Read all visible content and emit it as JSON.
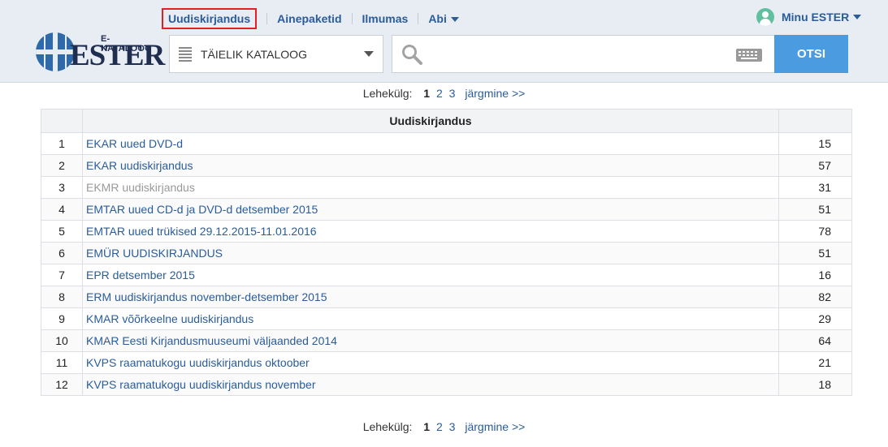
{
  "nav": {
    "items": [
      {
        "label": "Uudiskirjandus"
      },
      {
        "label": "Ainepaketid"
      },
      {
        "label": "Ilmumas"
      },
      {
        "label": "Abi"
      }
    ],
    "account_label": "Minu ESTER"
  },
  "logo": {
    "subtitle": "E-KATALOOG",
    "name": "ESTER"
  },
  "search": {
    "catalog_label": "TÄIELIK KATALOOG",
    "query": "",
    "button_label": "OTSI"
  },
  "pager": {
    "label": "Lehekülg:",
    "current": "1",
    "pages": [
      "2",
      "3"
    ],
    "next_label": "järgmine >>"
  },
  "table": {
    "header": "Uudiskirjandus",
    "rows": [
      {
        "num": "1",
        "name": "EKAR uued DVD-d",
        "count": "15",
        "linked": true
      },
      {
        "num": "2",
        "name": "EKAR uudiskirjandus",
        "count": "57",
        "linked": true
      },
      {
        "num": "3",
        "name": "EKMR uudiskirjandus",
        "count": "31",
        "linked": false
      },
      {
        "num": "4",
        "name": "EMTAR uued CD-d ja DVD-d detsember 2015",
        "count": "51",
        "linked": true
      },
      {
        "num": "5",
        "name": "EMTAR uued trükised 29.12.2015-11.01.2016",
        "count": "78",
        "linked": true
      },
      {
        "num": "6",
        "name": "EMÜR UUDISKIRJANDUS",
        "count": "51",
        "linked": true
      },
      {
        "num": "7",
        "name": "EPR detsember 2015",
        "count": "16",
        "linked": true
      },
      {
        "num": "8",
        "name": "ERM uudiskirjandus november-detsember 2015",
        "count": "82",
        "linked": true
      },
      {
        "num": "9",
        "name": "KMAR võõrkeelne uudiskirjandus",
        "count": "29",
        "linked": true
      },
      {
        "num": "10",
        "name": "KMAR Eesti Kirjandusmuuseumi väljaanded 2014",
        "count": "64",
        "linked": true
      },
      {
        "num": "11",
        "name": "KVPS raamatukogu uudiskirjandus oktoober",
        "count": "21",
        "linked": true
      },
      {
        "num": "12",
        "name": "KVPS raamatukogu uudiskirjandus november",
        "count": "18",
        "linked": true
      }
    ]
  },
  "colors": {
    "link": "#2a5c9a",
    "header_bg": "#e8edf4",
    "button": "#4a9be0",
    "highlight": "#e31e24"
  }
}
